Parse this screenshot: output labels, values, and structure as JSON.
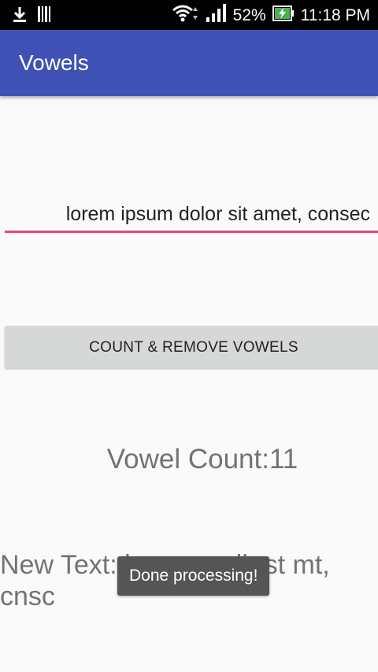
{
  "status_bar": {
    "battery_percent": "52%",
    "time": "11:18 PM",
    "icons": [
      "download-icon",
      "barcode-icon",
      "wifi-icon",
      "signal-icon",
      "battery-charging-icon"
    ]
  },
  "app_bar": {
    "title": "Vowels"
  },
  "input": {
    "value": "lorem ipsum dolor sit amet, consec"
  },
  "button": {
    "label": "COUNT & REMOVE VOWELS"
  },
  "vowel_count": {
    "text": "Vowel Count:11"
  },
  "result": {
    "text": "New Text: lrm psm dlr st mt, cnsc"
  },
  "toast": {
    "text": "Done processing!"
  },
  "colors": {
    "primary": "#3f51b5",
    "accent": "#e64a7f",
    "button_bg": "#d6d7d7",
    "background": "#fafafa"
  }
}
